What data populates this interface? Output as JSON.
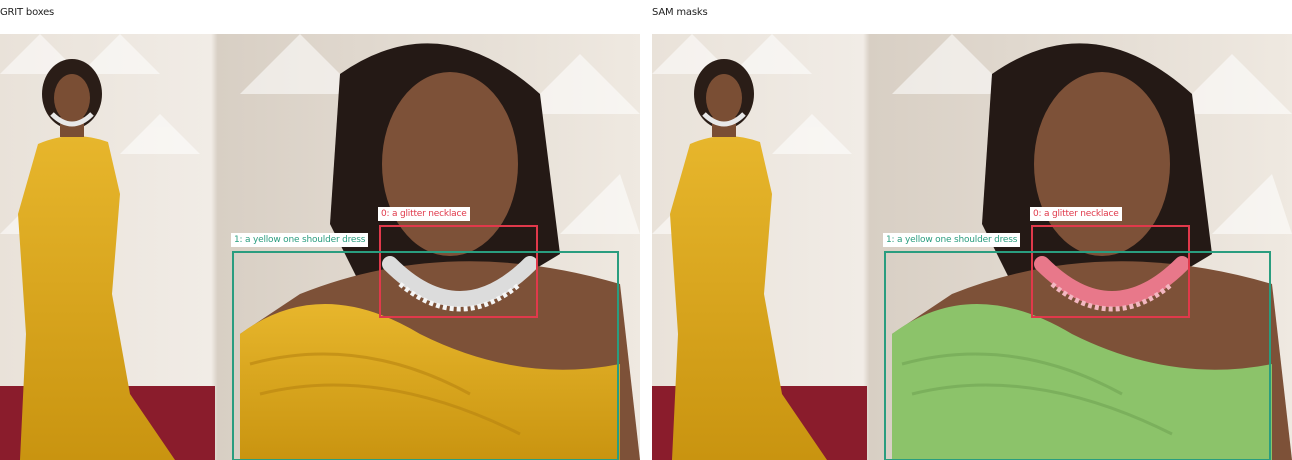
{
  "panels": {
    "left": {
      "title": "GRIT boxes"
    },
    "right": {
      "title": "SAM masks"
    }
  },
  "annotations": [
    {
      "label": "0: a glitter necklace",
      "color": "#e0394b"
    },
    {
      "label": "1: a yellow one shoulder dress",
      "color": "#2a9d7f"
    }
  ],
  "colors": {
    "mask_necklace": "#e8788a",
    "mask_dress": "#8cc36a"
  }
}
